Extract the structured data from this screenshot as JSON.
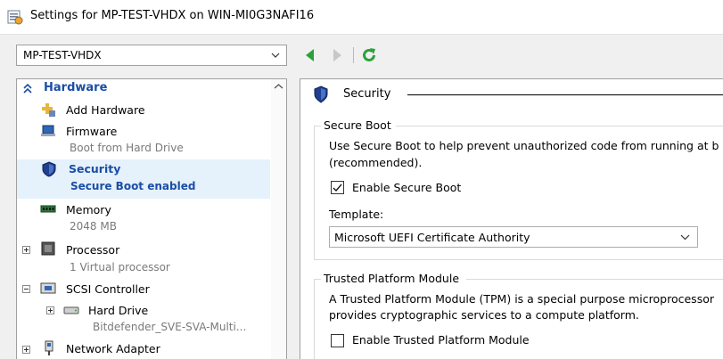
{
  "window": {
    "title": "Settings for MP-TEST-VHDX on WIN-MI0G3NAFI16"
  },
  "vm_selector": {
    "value": "MP-TEST-VHDX"
  },
  "nav": {
    "back_icon": "back-arrow-icon",
    "forward_icon": "forward-arrow-icon",
    "refresh_icon": "refresh-icon",
    "accent_green": "#2aa23a"
  },
  "tree": {
    "header": "Hardware",
    "items": [
      {
        "name": "Add Hardware",
        "sub": "",
        "icon": "add-hardware-icon"
      },
      {
        "name": "Firmware",
        "sub": "Boot from Hard Drive",
        "icon": "firmware-icon"
      },
      {
        "name": "Security",
        "sub": "Secure Boot enabled",
        "icon": "shield-icon",
        "selected": true
      },
      {
        "name": "Memory",
        "sub": "2048 MB",
        "icon": "memory-icon"
      },
      {
        "name": "Processor",
        "sub": "1 Virtual processor",
        "icon": "processor-icon"
      },
      {
        "name": "SCSI Controller",
        "sub": "",
        "icon": "scsi-controller-icon"
      },
      {
        "name": "Hard Drive",
        "sub": "Bitdefender_SVE-SVA-Multi...",
        "icon": "hard-drive-icon"
      },
      {
        "name": "Network Adapter",
        "sub": "",
        "icon": "network-adapter-icon"
      }
    ],
    "selected_color": "#1b4ea5",
    "selected_bg": "#e5f1fb"
  },
  "security": {
    "heading": "Security",
    "secure_boot": {
      "title": "Secure Boot",
      "description_line1": "Use Secure Boot to help prevent unauthorized code from running at b",
      "description_line2": "(recommended).",
      "checkbox_label": "Enable Secure Boot",
      "checked": true,
      "template_label": "Template:",
      "template_value": "Microsoft UEFI Certificate Authority"
    },
    "tpm": {
      "title": "Trusted Platform Module",
      "description_line1": "A Trusted Platform Module (TPM) is a special purpose microprocessor",
      "description_line2": "provides cryptographic services to a compute platform.",
      "checkbox_label": "Enable Trusted Platform Module",
      "checked": false
    }
  }
}
